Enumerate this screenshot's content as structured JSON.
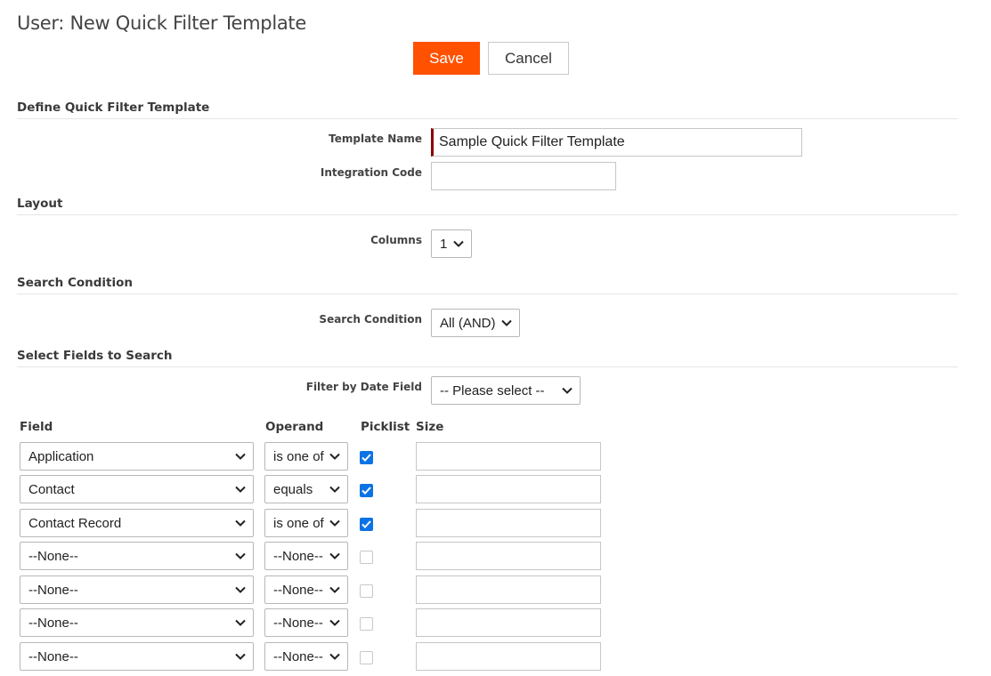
{
  "page": {
    "title": "User: New Quick Filter Template"
  },
  "toolbar": {
    "save_label": "Save",
    "cancel_label": "Cancel"
  },
  "colors": {
    "save_button": "#ff5100",
    "required_marker": "#8b0000",
    "checkbox_checked": "#0b73e5"
  },
  "sections": {
    "define": "Define Quick Filter Template",
    "layout": "Layout",
    "search_condition": "Search Condition",
    "select_fields": "Select Fields to Search"
  },
  "form": {
    "template_name": {
      "label": "Template Name",
      "value": "Sample Quick Filter Template"
    },
    "integration_code": {
      "label": "Integration Code",
      "value": ""
    },
    "columns": {
      "label": "Columns",
      "value": "1"
    },
    "search_condition": {
      "label": "Search Condition",
      "value": "All (AND)"
    },
    "filter_date_field": {
      "label": "Filter by Date Field",
      "value": "-- Please select --"
    }
  },
  "fields_table": {
    "headers": {
      "field": "Field",
      "operand": "Operand",
      "picklist": "Picklist",
      "size": "Size"
    },
    "rows": [
      {
        "field": "Application",
        "operand": "is one of",
        "picklist": true,
        "size": ""
      },
      {
        "field": "Contact",
        "operand": "equals",
        "picklist": true,
        "size": ""
      },
      {
        "field": "Contact Record",
        "operand": "is one of",
        "picklist": true,
        "size": ""
      },
      {
        "field": "--None--",
        "operand": "--None--",
        "picklist": false,
        "size": ""
      },
      {
        "field": "--None--",
        "operand": "--None--",
        "picklist": false,
        "size": ""
      },
      {
        "field": "--None--",
        "operand": "--None--",
        "picklist": false,
        "size": ""
      },
      {
        "field": "--None--",
        "operand": "--None--",
        "picklist": false,
        "size": ""
      }
    ]
  }
}
